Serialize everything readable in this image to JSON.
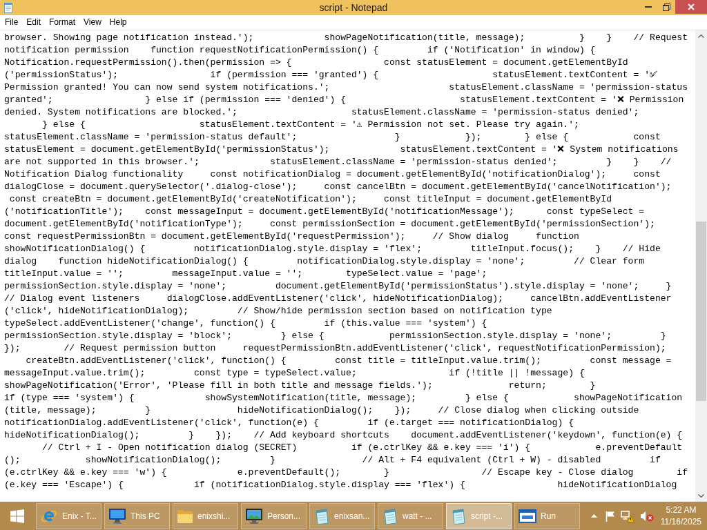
{
  "window": {
    "title": "script - Notepad"
  },
  "menu": [
    "File",
    "Edit",
    "Format",
    "View",
    "Help"
  ],
  "editor": {
    "lines": [
      "browser. Showing page notification instead.');             showPageNotification(title, message);          }    }    // Request",
      "notification permission    function requestNotificationPermission() {         if ('Notification' in window) {",
      "Notification.requestPermission().then(permission => {                 const statusElement = document.getElementById",
      "('permissionStatus');                 if (permission === 'granted') {                     statusElement.textContent = '✅",
      "Permission granted! You can now send system notifications.';                      statusElement.className = 'permission-status",
      "granted';                 } else if (permission === 'denied') {                     statusElement.textContent = '❌ Permission",
      "denied. System notifications are blocked.';                     statusElement.className = 'permission-status denied';",
      "       } else {                     statusElement.textContent = '⚠ Permission not set. Please try again.';",
      "statusElement.className = 'permission-status default';                  }            });        } else {            const",
      "statusElement = document.getElementById('permissionStatus');             statusElement.textContent = '❌ System notifications",
      "are not supported in this browser.';             statusElement.className = 'permission-status denied';         }    }    //",
      "Notification Dialog functionality     const notificationDialog = document.getElementById('notificationDialog');     const",
      "dialogClose = document.querySelector('.dialog-close');     const cancelBtn = document.getElementById('cancelNotification');",
      " const createBtn = document.getElementById('createNotification');     const titleInput = document.getElementById",
      "('notificationTitle');    const messageInput = document.getElementById('notificationMessage');      const typeSelect =",
      "document.getElementById('notificationType');     const permissionSection = document.getElementById('permissionSection');",
      "const requestPermissionBtn = document.getElementById('requestPermission');     // Show dialog     function",
      "showNotificationDialog() {         notificationDialog.style.display = 'flex';         titleInput.focus();    }    // Hide",
      "dialog    function hideNotificationDialog() {         notificationDialog.style.display = 'none';         // Clear form",
      "titleInput.value = '';         messageInput.value = '';        typeSelect.value = 'page';",
      "permissionSection.style.display = 'none';         document.getElementById('permissionStatus').style.display = 'none';     }",
      "// Dialog event listeners     dialogClose.addEventListener('click', hideNotificationDialog);     cancelBtn.addEventListener",
      "('click', hideNotificationDialog);         // Show/hide permission section based on notification type",
      "typeSelect.addEventListener('change', function() {         if (this.value === 'system') {",
      "permissionSection.style.display = 'block';         } else {            permissionSection.style.display = 'none';         }",
      "});        // Request permission button     requestPermissionBtn.addEventListener('click', requestNotificationPermission);",
      "    createBtn.addEventListener('click', function() {         const title = titleInput.value.trim();         const message =",
      "messageInput.value.trim();         const type = typeSelect.value;                 if (!title || !message) {",
      "showPageNotification('Error', 'Please fill in both title and message fields.');              return;        }",
      "if (type === 'system') {             showSystemNotification(title, message);         } else {            showPageNotification",
      "(title, message);         }                hideNotificationDialog();    });     // Close dialog when clicking outside",
      "notificationDialog.addEventListener('click', function(e) {         if (e.target === notificationDialog) {",
      "hideNotificationDialog();         }    });    // Add keyboard shortcuts    document.addEventListener('keydown', function(e) {",
      "       // Ctrl + I - Open notification dialog (SECRET)          if (e.ctrlKey && e.key === 'i') {            e.preventDefault",
      "();            showNotificationDialog();         }                // Alt + F4 equivalent (Ctrl + W) - disabled         if",
      "(e.ctrlKey && e.key === 'w') {             e.preventDefault();        }                 // Escape key - Close dialog        if",
      "(e.key === 'Escape') {             if (notificationDialog.style.display === 'flex') {                 hideNotificationDialog"
    ]
  },
  "taskbar": {
    "buttons": [
      {
        "kind": "browser",
        "label": "Enix - T...",
        "selected": false
      },
      {
        "kind": "computer",
        "label": "This PC",
        "selected": false
      },
      {
        "kind": "folder",
        "label": "enixshi...",
        "selected": false
      },
      {
        "kind": "display",
        "label": "Person...",
        "selected": false
      },
      {
        "kind": "notepad",
        "label": "enixsan...",
        "selected": false
      },
      {
        "kind": "notepad",
        "label": "watt - ...",
        "selected": false
      },
      {
        "kind": "notepad",
        "label": "script -...",
        "selected": true
      },
      {
        "kind": "run",
        "label": "Run",
        "selected": false
      }
    ],
    "tray": {
      "network_warning": true,
      "sound_muted": true
    },
    "clock": {
      "time": "5:22 AM",
      "date": "11/16/2025"
    }
  }
}
